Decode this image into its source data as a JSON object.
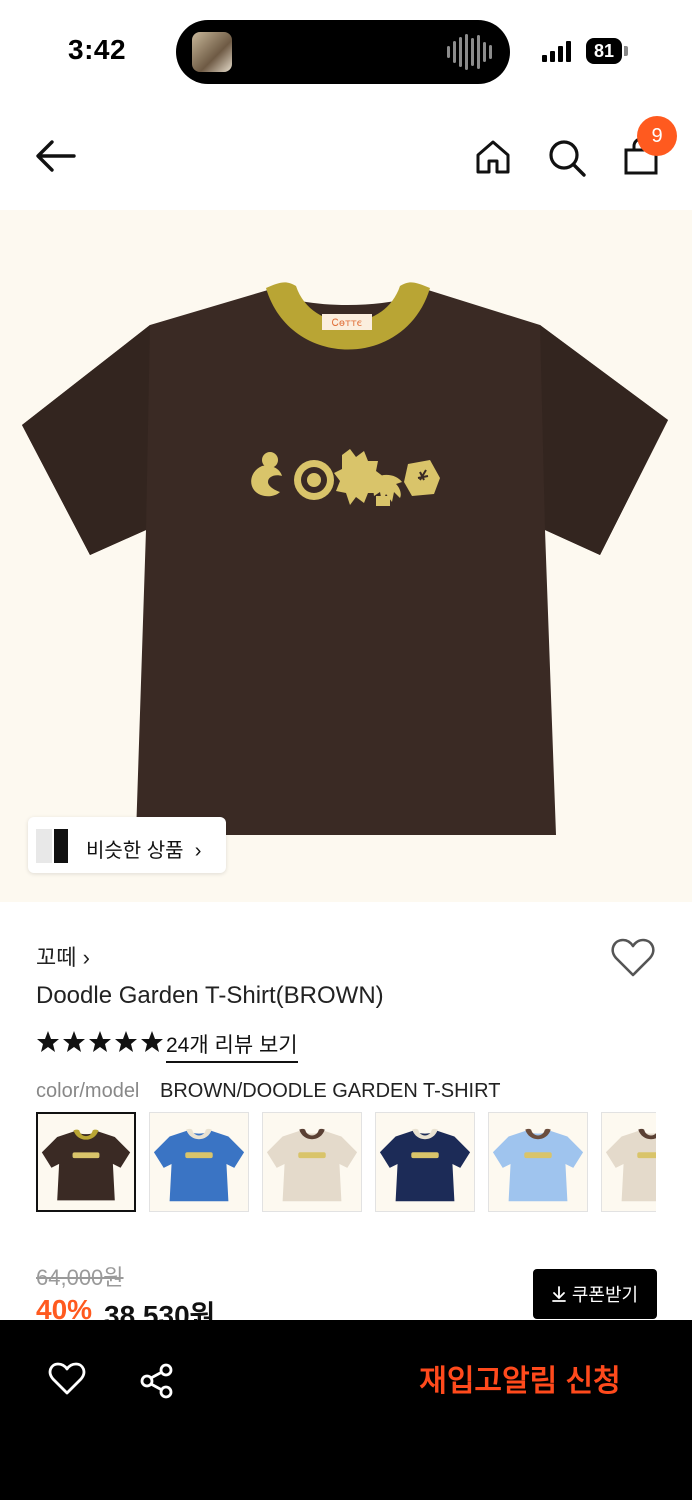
{
  "status_bar": {
    "time": "3:42",
    "battery": "81"
  },
  "header": {
    "cart_count": "9"
  },
  "hero": {
    "shirt_print_label": "Ꮯѳᴛᴛє",
    "similar_products_label": "비슷한 상품",
    "similar_products_chevron": "›"
  },
  "product": {
    "brand": "꼬떼",
    "brand_chevron": "›",
    "title": "Doodle Garden T-Shirt(BROWN)",
    "rating_stars": 5,
    "review_link": "24개 리뷰 보기",
    "option_label": "color/model",
    "option_value": "BROWN/DOODLE GARDEN T-SHIRT",
    "variants": [
      {
        "name": "brown",
        "body": "#3a2a24",
        "collar": "#b9a534",
        "selected": true
      },
      {
        "name": "blue",
        "body": "#3a74c4",
        "collar": "#e9e2d2",
        "selected": false
      },
      {
        "name": "beige",
        "body": "#e4dacb",
        "collar": "#5a4034",
        "selected": false
      },
      {
        "name": "navy",
        "body": "#1c2b57",
        "collar": "#e9e2d2",
        "selected": false
      },
      {
        "name": "light-blue",
        "body": "#9fc4ee",
        "collar": "#6b4e3e",
        "selected": false
      },
      {
        "name": "oatmeal",
        "body": "#e4dacb",
        "collar": "#5a4034",
        "selected": false
      }
    ]
  },
  "price": {
    "original": "64,000원",
    "discount": "40%",
    "final": "38,530원",
    "coupon_label": "쿠폰받기"
  },
  "bottom_bar": {
    "restock_label": "재입고알림 신청"
  },
  "colors": {
    "accent": "#ff5a1f",
    "hero_bg": "#fdf9f0",
    "shirt_body": "#3a2a24",
    "shirt_collar": "#b9a534",
    "print": "#d9c46a"
  }
}
